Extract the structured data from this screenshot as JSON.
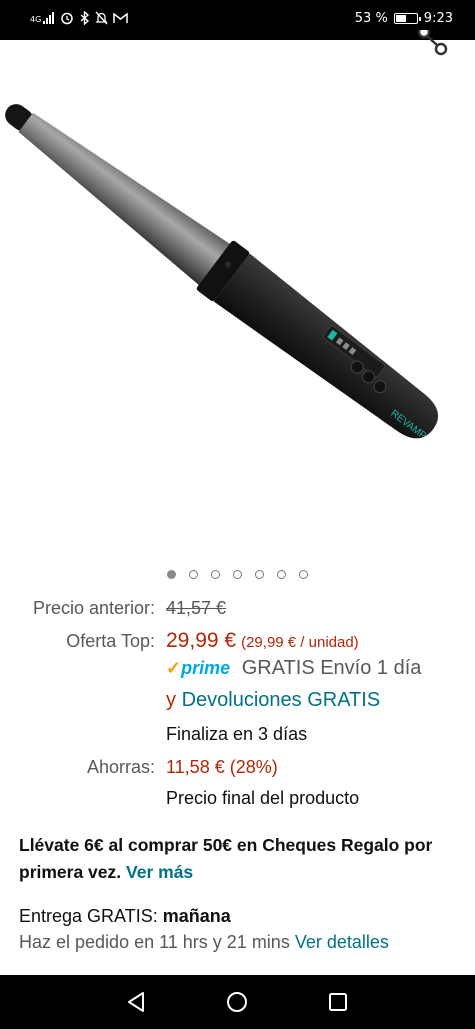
{
  "status_bar": {
    "network": "4G",
    "battery_percent": "53 %",
    "battery_level": 0.53,
    "time": "9:23"
  },
  "product": {
    "brand_on_image": "REVAMP",
    "image_count": 7,
    "active_image_index": 0
  },
  "pricing": {
    "previous_label": "Precio anterior:",
    "previous_price": "41,57 €",
    "deal_label": "Oferta Top:",
    "deal_price": "29,99 €",
    "unit_price": "(29,99 € / unidad)",
    "prime_logo": "prime",
    "prime_text_1": "GRATIS Envío 1 día",
    "prime_text_2_prefix": "y",
    "prime_text_2_link": "Devoluciones GRATIS",
    "ends_in": "Finaliza en 3 días",
    "savings_label": "Ahorras:",
    "savings_value": "11,58 € (28%)",
    "final_price_note": "Precio final del producto"
  },
  "promo": {
    "text": "Llévate 6€ al comprar 50€ en Cheques Regalo por primera vez.",
    "link": "Ver más"
  },
  "delivery": {
    "label": "Entrega GRATIS:",
    "day": "mañana",
    "order_within": "Haz el pedido en 11 hrs y 21 mins",
    "details_link": "Ver detalles"
  },
  "nav_bar": {
    "icons": [
      "back-icon",
      "home-icon",
      "recents-icon"
    ]
  }
}
